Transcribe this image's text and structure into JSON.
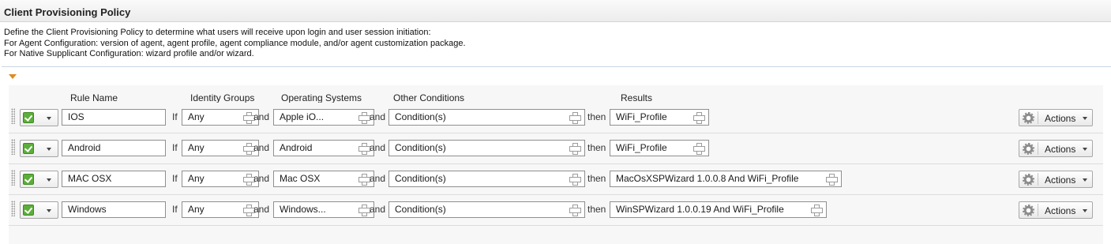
{
  "page": {
    "title": "Client Provisioning Policy",
    "description": [
      "Define the Client Provisioning Policy to determine what users will receive upon login and user session initiation:",
      "For Agent Configuration: version of agent, agent profile, agent compliance module, and/or agent customization package.",
      "For Native Supplicant Configuration: wizard profile and/or wizard."
    ]
  },
  "columns": {
    "rule_name": "Rule Name",
    "identity_groups": "Identity Groups",
    "operating_systems": "Operating Systems",
    "other_conditions": "Other Conditions",
    "results": "Results"
  },
  "connectors": {
    "if": "If",
    "and": "and",
    "then": "then"
  },
  "actions_label": "Actions",
  "status_color": "#5cae3a",
  "rules": [
    {
      "enabled": true,
      "name": "IOS",
      "identity_group": "Any",
      "os": "Apple iO...",
      "conditions": "Condition(s)",
      "result": "WiFi_Profile"
    },
    {
      "enabled": true,
      "name": "Android",
      "identity_group": "Any",
      "os": "Android",
      "conditions": "Condition(s)",
      "result": "WiFi_Profile"
    },
    {
      "enabled": true,
      "name": "MAC OSX",
      "identity_group": "Any",
      "os": "Mac OSX",
      "conditions": "Condition(s)",
      "result": "MacOsXSPWizard 1.0.0.8 And WiFi_Profile"
    },
    {
      "enabled": true,
      "name": "Windows",
      "identity_group": "Any",
      "os": "Windows...",
      "conditions": "Condition(s)",
      "result": "WinSPWizard 1.0.0.19 And WiFi_Profile"
    }
  ]
}
